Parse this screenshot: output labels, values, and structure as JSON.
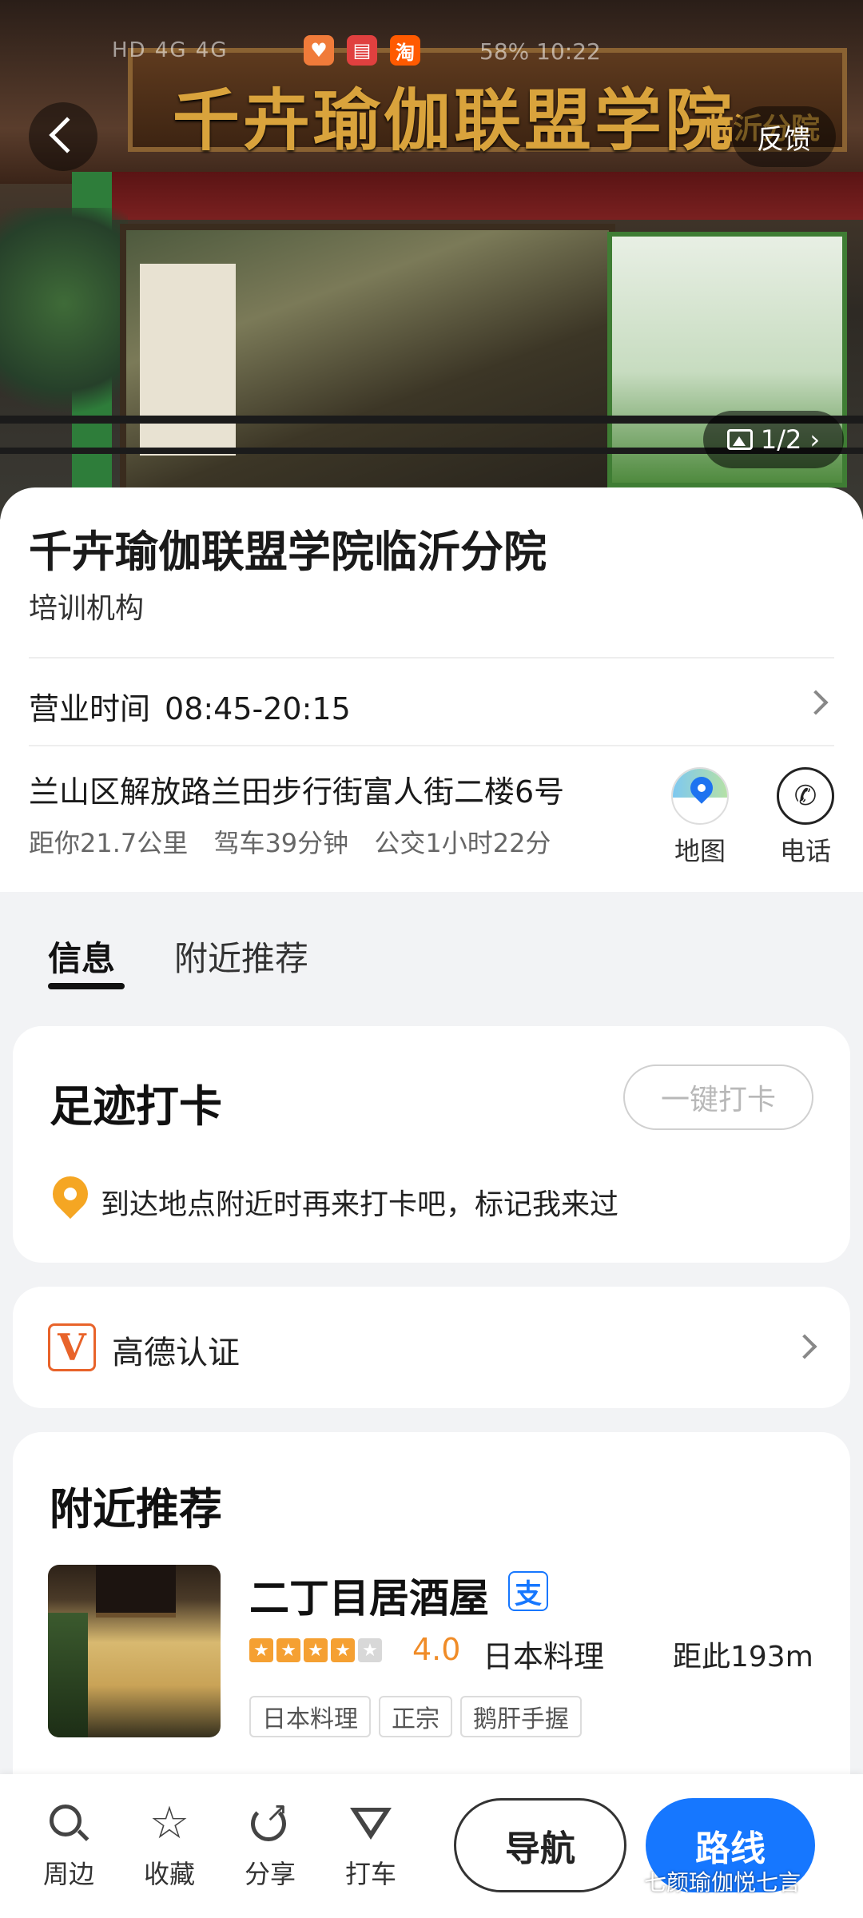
{
  "status_bar": {
    "left": "HD 4G 4G",
    "apps": [
      {
        "glyph": "♥",
        "color": "#f07b3a"
      },
      {
        "glyph": "▤",
        "color": "#e0403f"
      },
      {
        "glyph": "淘",
        "color": "#ff5a00"
      }
    ],
    "right": "58% 10:22"
  },
  "hero": {
    "banner_text": "千卉瑜伽联盟学院",
    "banner_sub": "临沂分院",
    "feedback_label": "反馈",
    "photo_counter": "1/2"
  },
  "place": {
    "name": "千卉瑜伽联盟学院临沂分院",
    "category": "培训机构",
    "hours_label": "营业时间",
    "hours_value": "08:45-20:15",
    "address": "兰山区解放路兰田步行街富人街二楼6号",
    "distance": "距你21.7公里",
    "drive": "驾车39分钟",
    "transit": "公交1小时22分",
    "map_label": "地图",
    "call_label": "电话"
  },
  "tabs": [
    {
      "label": "信息",
      "active": true
    },
    {
      "label": "附近推荐",
      "active": false
    }
  ],
  "checkin": {
    "title": "足迹打卡",
    "button": "一键打卡",
    "hint": "到达地点附近时再来打卡吧，标记我来过"
  },
  "verify": {
    "badge": "V",
    "label": "高德认证"
  },
  "nearby": {
    "title": "附近推荐",
    "item": {
      "name": "二丁目居酒屋",
      "pay_badge": "支",
      "rating": "4.0",
      "rating_stars": 4,
      "cuisine": "日本料理",
      "distance": "距此193m",
      "tags": [
        "日本料理",
        "正宗",
        "鹅肝手握"
      ]
    }
  },
  "bottom_bar": {
    "items": [
      {
        "label": "周边",
        "icon": "search-icon"
      },
      {
        "label": "收藏",
        "icon": "star-icon"
      },
      {
        "label": "分享",
        "icon": "share-icon"
      },
      {
        "label": "打车",
        "icon": "taxi-icon"
      }
    ],
    "nav_label": "导航",
    "route_label": "路线"
  },
  "watermark": "七颜瑜伽悦七言",
  "colors": {
    "primary_blue": "#1677ff",
    "rating_orange": "#f08c28",
    "verify_orange": "#e8632a"
  }
}
